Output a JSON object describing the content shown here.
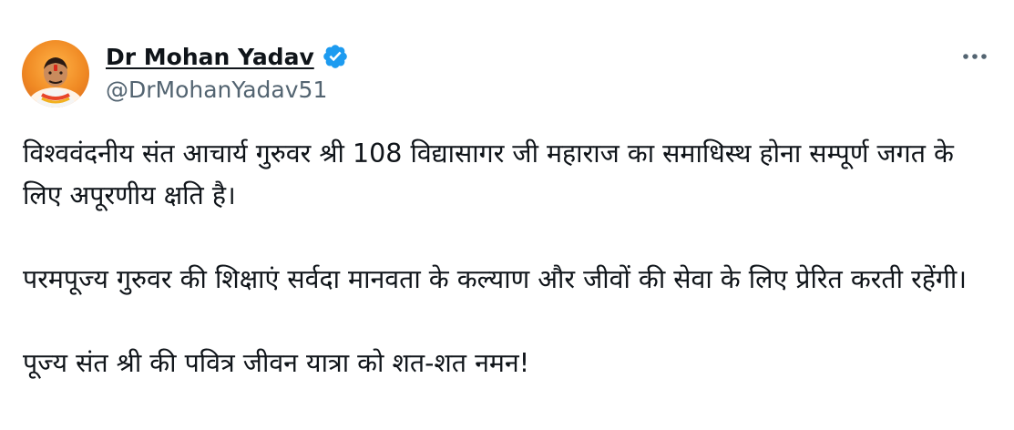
{
  "author": {
    "display_name": "Dr Mohan Yadav",
    "handle": "@DrMohanYadav51",
    "verified": true,
    "avatar_icon": "profile-photo-avatar",
    "badge_color": "#1d9bf0"
  },
  "header": {
    "more_icon": "more-options-icon"
  },
  "tweet": {
    "paragraphs": [
      "विश्ववंदनीय संत आचार्य गुरुवर श्री 108 विद्यासागर जी महाराज का समाधिस्थ होना सम्पूर्ण जगत के लिए अपूरणीय क्षति है।",
      "परमपूज्य गुरुवर की शिक्षाएं सर्वदा मानवता के कल्याण और जीवों की सेवा के लिए प्रेरित करती रहेंगी।",
      "पूज्य संत श्री की पवित्र जीवन यात्रा को शत-शत नमन!"
    ]
  },
  "colors": {
    "text": "#0f1419",
    "secondary": "#536471",
    "verified": "#1d9bf0"
  }
}
